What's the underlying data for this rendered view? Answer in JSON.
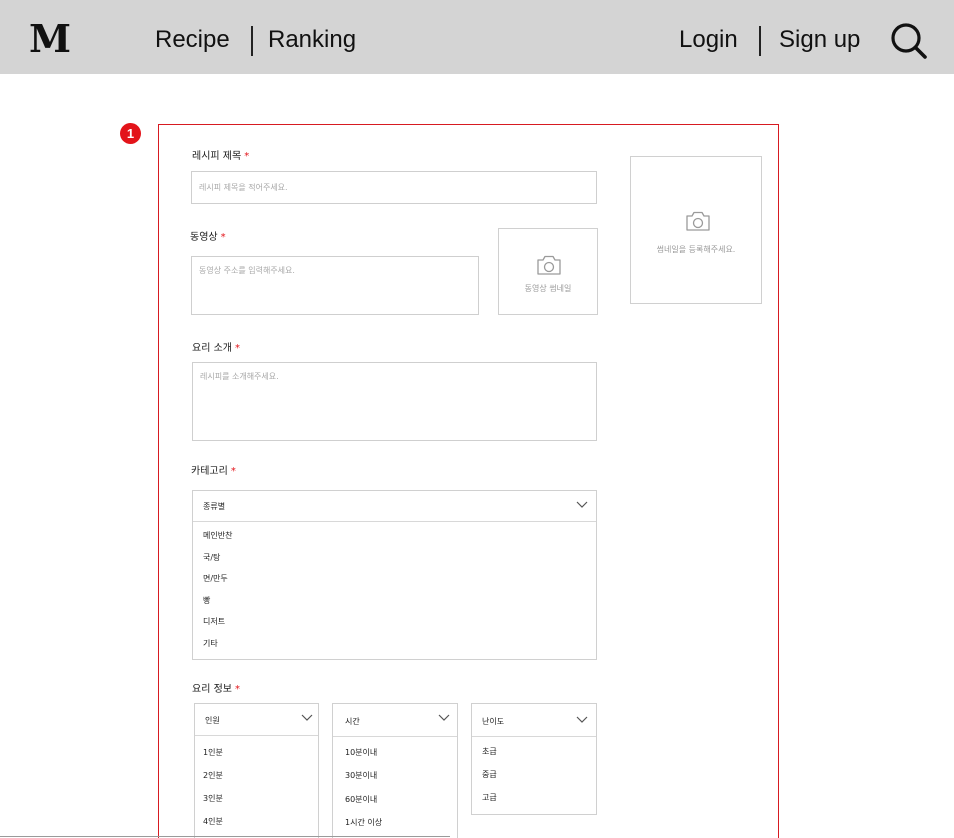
{
  "header": {
    "logo": "M",
    "nav": [
      "Recipe",
      "Ranking"
    ],
    "auth": [
      "Login",
      "Sign up"
    ],
    "search_icon": "search-icon"
  },
  "badge": "1",
  "form": {
    "title": {
      "label": "레시피 제목",
      "required": "*",
      "placeholder": "레시피 제목을 적어주세요."
    },
    "main_thumbnail": {
      "icon": "camera-icon",
      "text": "썸네일을 등록해주세요."
    },
    "video": {
      "label": "동영상",
      "required": "*",
      "placeholder": "동영상 주소를 입력해주세요.",
      "thumb_icon": "camera-icon",
      "thumb_text": "동영상 썸네일"
    },
    "intro": {
      "label": "요리 소개",
      "required": "*",
      "placeholder": "레시피를 소개해주세요."
    },
    "category": {
      "label": "카테고리",
      "required": "*",
      "selected": "종류별",
      "options": [
        "메인반찬",
        "국/탕",
        "면/만두",
        "빵",
        "디저트",
        "기타"
      ]
    },
    "info": {
      "label": "요리 정보",
      "required": "*",
      "servings": {
        "selected": "인원",
        "options": [
          "1인분",
          "2인분",
          "3인분",
          "4인분"
        ]
      },
      "time": {
        "selected": "시간",
        "options": [
          "10분이내",
          "30분이내",
          "60분이내",
          "1시간 이상"
        ]
      },
      "difficulty": {
        "selected": "난이도",
        "options": [
          "초급",
          "중급",
          "고급"
        ]
      }
    }
  },
  "colors": {
    "header_bg": "#d4d4d4",
    "frame": "#d71a21",
    "required": "#e3141a"
  }
}
